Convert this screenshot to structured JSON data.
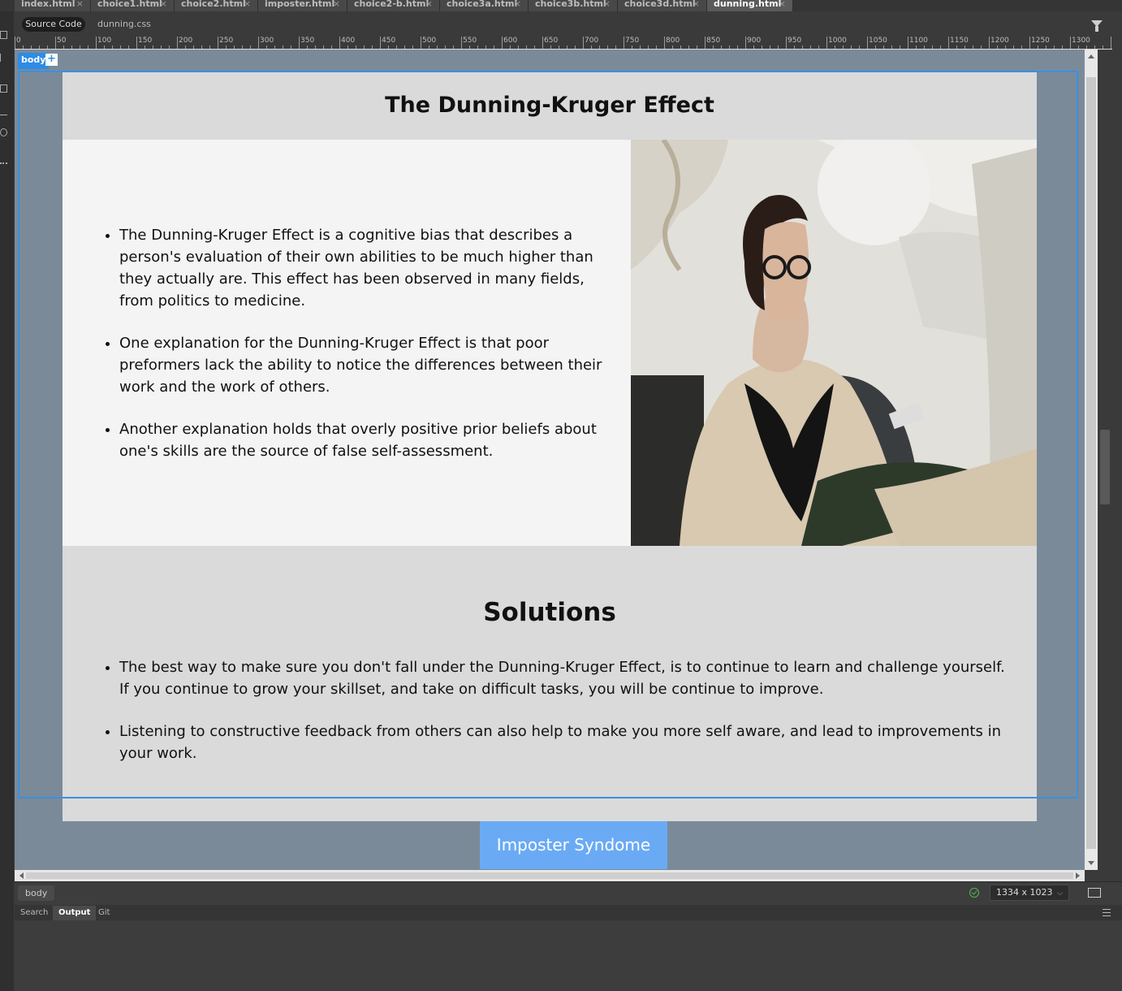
{
  "tabs": [
    {
      "label": "index.html",
      "active": false
    },
    {
      "label": "choice1.html",
      "active": false
    },
    {
      "label": "choice2.html",
      "active": false
    },
    {
      "label": "imposter.html",
      "active": false
    },
    {
      "label": "choice2-b.html",
      "active": false
    },
    {
      "label": "choice3a.html",
      "active": false
    },
    {
      "label": "choice3b.html",
      "active": false
    },
    {
      "label": "choice3d.html",
      "active": false
    },
    {
      "label": "dunning.html",
      "active": true
    }
  ],
  "close_glyph": "×",
  "related_files": {
    "source_code": "Source Code",
    "css_file": "dunning.css"
  },
  "ruler": {
    "labels": [
      "0",
      "50",
      "100",
      "150",
      "200",
      "250",
      "300",
      "350",
      "400",
      "450",
      "500",
      "550",
      "600",
      "650",
      "700",
      "750",
      "800",
      "850",
      "900",
      "950",
      "1000",
      "1050",
      "1100",
      "1150",
      "1200",
      "1250",
      "1300"
    ]
  },
  "design": {
    "selected_tag": "body",
    "add_glyph": "+",
    "title": "The Dunning-Kruger Effect",
    "intro_points": [
      "The Dunning-Kruger Effect is a cognitive bias that describes a person's evaluation of their own abilities to be much higher than they actually are. This effect has been observed in many fields, from politics to medicine.",
      "One explanation for the Dunning-Kruger Effect is that poor preformers lack the ability to notice the differences between their work and the work of others.",
      "Another explanation holds that overly positive prior beliefs about one's skills are the source of false self-assessment."
    ],
    "solutions_heading": "Solutions",
    "solutions_points": [
      "The best way to make sure you don't fall under the Dunning-Kruger Effect, is to continue to learn and challenge yourself. If you continue to grow your skillset, and take on difficult tasks, you will be continue to improve.",
      "Listening to constructive feedback from others can also help to make you more self aware, and lead to improvements in your work."
    ],
    "nav_button": "Imposter Syndome",
    "colors": {
      "page_bg": "#7a8a99",
      "section_bg": "#dadada",
      "intro_bg": "#f4f4f4",
      "button_bg": "#6aaaf5",
      "selection": "#3d8fe0"
    }
  },
  "status": {
    "tag": "body",
    "size": "1334 x 1023"
  },
  "panel": {
    "tabs": [
      {
        "label": "Search",
        "active": false
      },
      {
        "label": "Output",
        "active": true
      },
      {
        "label": "Git",
        "active": false
      }
    ]
  }
}
